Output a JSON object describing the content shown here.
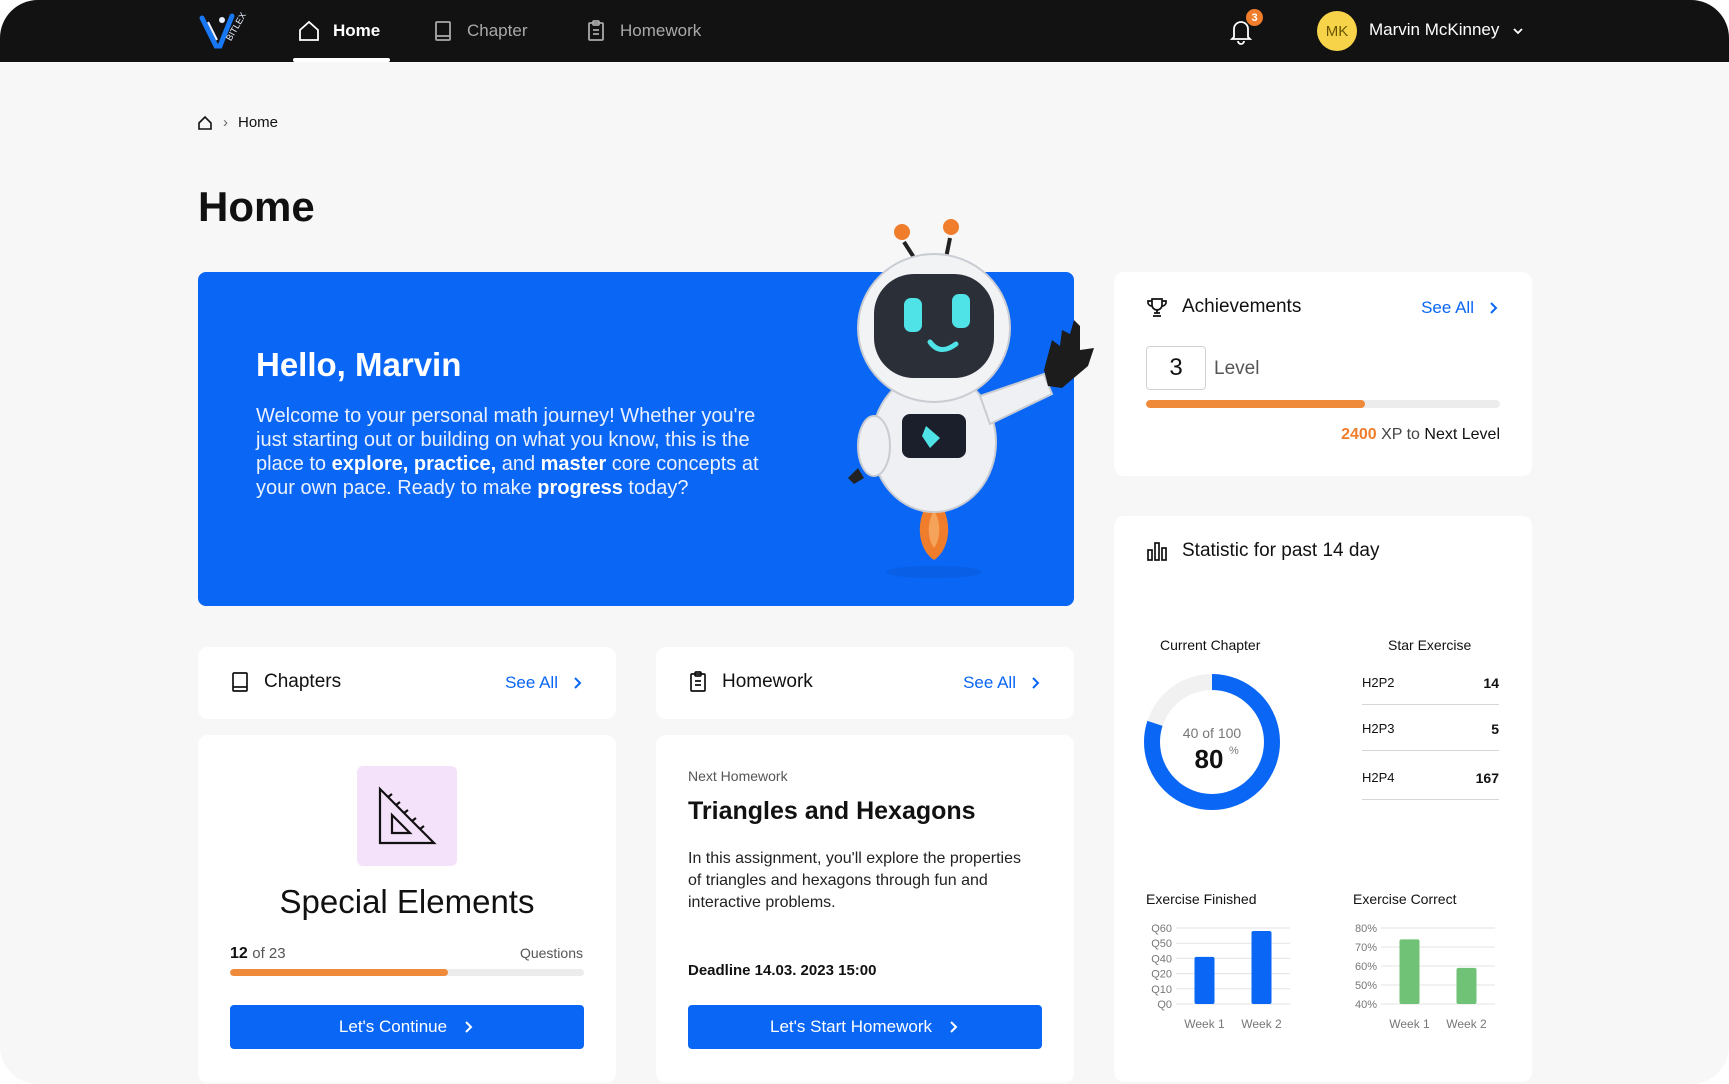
{
  "nav": {
    "items": [
      {
        "label": "Home",
        "icon": "home-icon"
      },
      {
        "label": "Chapter",
        "icon": "book-icon"
      },
      {
        "label": "Homework",
        "icon": "clipboard-icon"
      }
    ],
    "notification_count": "3",
    "user": {
      "initials": "MK",
      "name": "Marvin McKinney"
    }
  },
  "breadcrumb": {
    "current": "Home"
  },
  "page": {
    "title": "Home"
  },
  "hero": {
    "greeting": "Hello, Marvin",
    "text_1": "Welcome to your personal math journey! Whether you're just starting out or building on what you know, this is the place to ",
    "bold_1": "explore, practice,",
    "text_2": " and ",
    "bold_2": "master",
    "text_3": " core concepts at your own pace. Ready to make ",
    "bold_3": "progress",
    "text_4": " today?"
  },
  "achievements": {
    "title": "Achievements",
    "see_all": "See All",
    "level": "3",
    "level_label": "Level",
    "progress": 0.62,
    "xp": "2400",
    "xp_to": "XP to",
    "xp_next": "Next Level"
  },
  "statistics": {
    "title": "Statistic for past 14 day",
    "current_chapter": {
      "label": "Current Chapter",
      "of_text": "40 of 100",
      "percent": "80",
      "percent_sign": "%",
      "value": 0.8
    },
    "star_exercise": {
      "label": "Star Exercise",
      "rows": [
        {
          "name": "H2P2",
          "value": "14"
        },
        {
          "name": "H2P3",
          "value": "5"
        },
        {
          "name": "H2P4",
          "value": "167"
        }
      ]
    }
  },
  "chapters": {
    "title": "Chapters",
    "see_all": "See All",
    "card": {
      "name": "Special Elements",
      "done": "12",
      "of_total": "of 23",
      "questions_label": "Questions",
      "progress": 0.615,
      "button": "Let's Continue"
    }
  },
  "homework": {
    "title": "Homework",
    "see_all": "See All",
    "card": {
      "kicker": "Next Homework",
      "name": "Triangles and Hexagons",
      "description": "In this assignment, you'll explore the properties of triangles and hexagons through fun and interactive problems.",
      "deadline": "Deadline 14.03. 2023 15:00",
      "button": "Let's Start Homework"
    }
  },
  "chart_data": [
    {
      "type": "bar",
      "title": "Exercise Finished",
      "categories": [
        "Week 1",
        "Week 2"
      ],
      "values": [
        31,
        48
      ],
      "yticks": [
        "Q60",
        "Q50",
        "Q40",
        "Q20",
        "Q10",
        "Q0"
      ],
      "color": "#0a66f5"
    },
    {
      "type": "bar",
      "title": "Exercise Correct",
      "categories": [
        "Week 1",
        "Week 2"
      ],
      "values": [
        74,
        59
      ],
      "yticks": [
        "80%",
        "70%",
        "60%",
        "50%",
        "40%"
      ],
      "ylim": [
        40,
        80
      ],
      "color": "#6fc276"
    }
  ]
}
